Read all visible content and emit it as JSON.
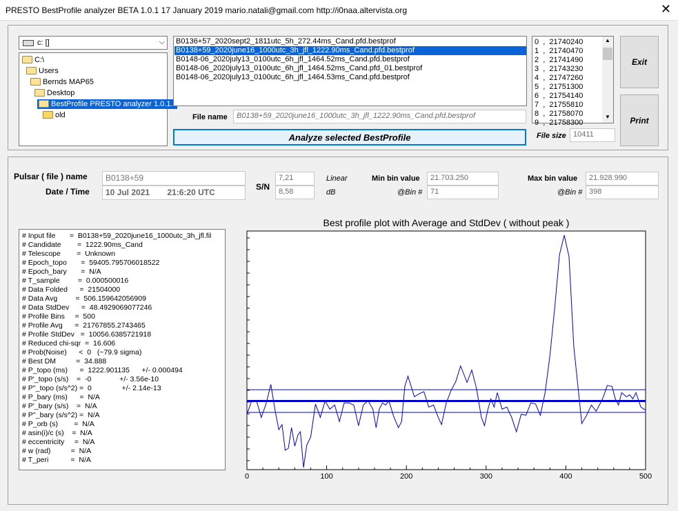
{
  "window": {
    "title": "PRESTO BestProfile analyzer BETA 1.0.1    17 January 2019       mario.natali@gmail.com       http://i0naa.altervista.org",
    "close_label": "✕"
  },
  "drive": {
    "value": "c: []"
  },
  "tree": [
    {
      "label": "C:\\",
      "indent": 0,
      "selected": false
    },
    {
      "label": "Users",
      "indent": 1,
      "selected": false
    },
    {
      "label": "Bernds MAP65",
      "indent": 2,
      "selected": false
    },
    {
      "label": "Desktop",
      "indent": 3,
      "selected": false
    },
    {
      "label": "BestProfile PRESTO analyzer 1.0.1.e",
      "indent": 4,
      "selected": true
    },
    {
      "label": "old",
      "indent": 5,
      "selected": false
    }
  ],
  "files": [
    {
      "label": "B0136+57_2020sept2_1811utc_5h_272.44ms_Cand.pfd.bestprof",
      "selected": false
    },
    {
      "label": "B0138+59_2020june16_1000utc_3h_jfl_1222.90ms_Cand.pfd.bestprof",
      "selected": true
    },
    {
      "label": "B0148-06_2020july13_0100utc_6h_jfl_1464.52ms_Cand.pfd.bestprof",
      "selected": false
    },
    {
      "label": "B0148-06_2020july13_0100utc_6h_jfl_1464.52ms_Cand.pfd_01.bestprof",
      "selected": false
    },
    {
      "label": "B0148-06_2020july13_0100utc_6h_jfl_1464.53ms_Cand.pfd.bestprof",
      "selected": false
    }
  ],
  "numlist": [
    "0  ,  21740240",
    "1  ,  21740470",
    "2  ,  21741490",
    "3  ,  21743230",
    "4  ,  21747260",
    "5  ,  21751300",
    "6  ,  21754140",
    "7  ,  21755810",
    "8  ,  21758070",
    "9  ,  21758300"
  ],
  "buttons": {
    "exit": "Exit",
    "print": "Print",
    "analyze": "Analyze selected BestProfile"
  },
  "file_name": {
    "label": "File name",
    "value": "B0138+59_2020june16_1000utc_3h_jfl_1222.90ms_Cand.pfd.bestprof"
  },
  "file_size": {
    "label": "File size",
    "value": "10411"
  },
  "pulsar": {
    "name_label": "Pulsar ( file ) name",
    "name": "B0138+59",
    "datetime_label": "Date / Time",
    "date": "10 Jul 2021",
    "time": "21:6:20  UTC"
  },
  "sn": {
    "label": "S/N",
    "linear": "7,21",
    "linear_label": "Linear",
    "db": "8,58",
    "db_label": "dB"
  },
  "min_bin": {
    "label": "Min bin value",
    "value": "21.703.250",
    "bin_label": "@Bin #",
    "bin": "71"
  },
  "max_bin": {
    "label": "Max bin value",
    "value": "21.928.990",
    "bin_label": "@Bin #",
    "bin": "398"
  },
  "info_lines": [
    "# Input file       =  B0138+59_2020june16_1000utc_3h_jfl.fil",
    "# Candidate        =  1222.90ms_Cand",
    "# Telescope        =  Unknown",
    "# Epoch_topo       =  59405.795706018522",
    "# Epoch_bary       =  N/A",
    "# T_sample         =  0.000500016",
    "# Data Folded      =  21504000",
    "# Data Avg         =  506.159642056909",
    "# Data StdDev      =  48.4929069077246",
    "# Profile Bins     =  500",
    "# Profile Avg      =  21767855.2743465",
    "# Profile StdDev   =  10056.6385721918",
    "# Reduced chi-sqr  =  16.606",
    "# Prob(Noise)      <  0   (~79.9 sigma)",
    "# Best DM          =  34.888",
    "# P_topo (ms)      =  1222.901135      +/- 0.000494",
    "# P'_topo (s/s)    =  -0              +/- 3.56e-10",
    "# P''_topo (s/s^2) =  0               +/- 2.14e-13",
    "# P_bary (ms)      =  N/A",
    "# P'_bary (s/s)    =  N/A",
    "# P''_bary (s/s^2) =  N/A",
    "# P_orb (s)        =  N/A",
    "# asin(i)/c (s)    =  N/A",
    "# eccentricity     =  N/A",
    "# w (rad)          =  N/A",
    "# T_peri           =  N/A"
  ],
  "chart_data": {
    "type": "line",
    "title": "Best profile plot with  Average and StdDev ( without peak )",
    "xlim": [
      0,
      500
    ],
    "xticks": [
      0,
      100,
      200,
      300,
      400,
      500
    ],
    "ylim": [
      21703250,
      21928990
    ],
    "avg": 21767855,
    "std_upper": 21778900,
    "std_lower": 21756800,
    "colors": {
      "profile": "#0000cc",
      "avg": "#0000cc",
      "std": "#0000cc"
    },
    "profile_keypoints": [
      [
        0,
        21755000
      ],
      [
        6,
        21768000
      ],
      [
        12,
        21768000
      ],
      [
        18,
        21752000
      ],
      [
        24,
        21765000
      ],
      [
        30,
        21784000
      ],
      [
        35,
        21760000
      ],
      [
        40,
        21740000
      ],
      [
        44,
        21745000
      ],
      [
        48,
        21720000
      ],
      [
        52,
        21722000
      ],
      [
        56,
        21742000
      ],
      [
        60,
        21724000
      ],
      [
        64,
        21735000
      ],
      [
        67,
        21738000
      ],
      [
        71,
        21703250
      ],
      [
        75,
        21725000
      ],
      [
        80,
        21733000
      ],
      [
        86,
        21765000
      ],
      [
        92,
        21752000
      ],
      [
        98,
        21768000
      ],
      [
        104,
        21760000
      ],
      [
        110,
        21764000
      ],
      [
        116,
        21748000
      ],
      [
        122,
        21766000
      ],
      [
        128,
        21766000
      ],
      [
        134,
        21764000
      ],
      [
        140,
        21744000
      ],
      [
        146,
        21764000
      ],
      [
        152,
        21768000
      ],
      [
        158,
        21760000
      ],
      [
        162,
        21742000
      ],
      [
        166,
        21760000
      ],
      [
        170,
        21766000
      ],
      [
        174,
        21764000
      ],
      [
        178,
        21768000
      ],
      [
        184,
        21753000
      ],
      [
        190,
        21742000
      ],
      [
        194,
        21748000
      ],
      [
        198,
        21782000
      ],
      [
        202,
        21792000
      ],
      [
        206,
        21782000
      ],
      [
        210,
        21772000
      ],
      [
        216,
        21775000
      ],
      [
        222,
        21777000
      ],
      [
        228,
        21762000
      ],
      [
        234,
        21764000
      ],
      [
        240,
        21752000
      ],
      [
        244,
        21745000
      ],
      [
        250,
        21766000
      ],
      [
        256,
        21778000
      ],
      [
        262,
        21787000
      ],
      [
        268,
        21802000
      ],
      [
        272,
        21794000
      ],
      [
        276,
        21786000
      ],
      [
        282,
        21798000
      ],
      [
        288,
        21780000
      ],
      [
        294,
        21752000
      ],
      [
        298,
        21744000
      ],
      [
        302,
        21759000
      ],
      [
        306,
        21770000
      ],
      [
        310,
        21762000
      ],
      [
        314,
        21776000
      ],
      [
        320,
        21760000
      ],
      [
        326,
        21762000
      ],
      [
        332,
        21752000
      ],
      [
        338,
        21738000
      ],
      [
        344,
        21755000
      ],
      [
        350,
        21754000
      ],
      [
        356,
        21766000
      ],
      [
        362,
        21765000
      ],
      [
        368,
        21754000
      ],
      [
        374,
        21776000
      ],
      [
        380,
        21812000
      ],
      [
        386,
        21858000
      ],
      [
        392,
        21910000
      ],
      [
        398,
        21928990
      ],
      [
        404,
        21908000
      ],
      [
        410,
        21820000
      ],
      [
        416,
        21776000
      ],
      [
        420,
        21746000
      ],
      [
        426,
        21754000
      ],
      [
        432,
        21764000
      ],
      [
        438,
        21758000
      ],
      [
        446,
        21770000
      ],
      [
        452,
        21783000
      ],
      [
        458,
        21782000
      ],
      [
        462,
        21770000
      ],
      [
        466,
        21764000
      ],
      [
        470,
        21776000
      ],
      [
        476,
        21772000
      ],
      [
        480,
        21774000
      ],
      [
        484,
        21770000
      ],
      [
        488,
        21776000
      ],
      [
        494,
        21762000
      ],
      [
        500,
        21759000
      ]
    ]
  }
}
